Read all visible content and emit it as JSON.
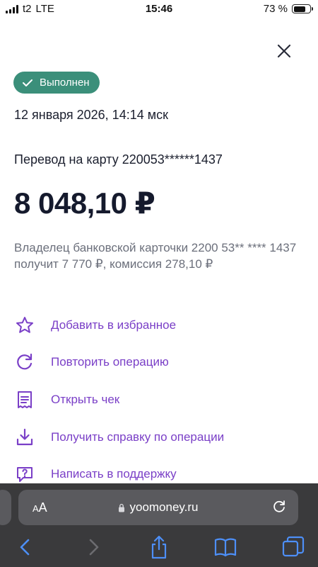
{
  "status_bar": {
    "carrier": "t2",
    "network": "LTE",
    "time": "15:46",
    "battery_percent": "73 %",
    "battery_level": 0.73
  },
  "close": {
    "icon": "close-icon"
  },
  "badge": {
    "label": "Выполнен",
    "color": "#3b8f7a"
  },
  "operation": {
    "date": "12 января 2026, 14:14 мск",
    "title": "Перевод на карту 220053******1437",
    "amount": "8 048,10 ₽",
    "description": "Владелец банковской карточки 2200 53** **** 1437 получит 7 770 ₽, комиссия 278,10 ₽"
  },
  "actions": [
    {
      "label": "Добавить в избранное",
      "icon": "star-icon"
    },
    {
      "label": "Повторить операцию",
      "icon": "repeat-icon"
    },
    {
      "label": "Открыть чек",
      "icon": "receipt-icon"
    },
    {
      "label": "Получить справку по операции",
      "icon": "download-icon"
    },
    {
      "label": "Написать в поддержку",
      "icon": "chat-question-icon"
    }
  ],
  "accent_color": "#7a3fc7",
  "browser": {
    "text_size_label": "AA",
    "url": "yoomoney.ru"
  }
}
